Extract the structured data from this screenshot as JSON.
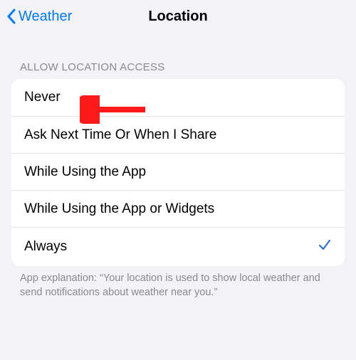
{
  "nav": {
    "back_label": "Weather",
    "title": "Location"
  },
  "section_header": "ALLOW LOCATION ACCESS",
  "options": [
    {
      "label": "Never",
      "selected": false
    },
    {
      "label": "Ask Next Time Or When I Share",
      "selected": false
    },
    {
      "label": "While Using the App",
      "selected": false
    },
    {
      "label": "While Using the App or Widgets",
      "selected": false
    },
    {
      "label": "Always",
      "selected": true
    }
  ],
  "footer": "App explanation: “Your location is used to show local weather and send notifications about weather near you.”",
  "annotation": {
    "type": "arrow",
    "color": "#ff1a1a",
    "target_option_index": 0
  },
  "colors": {
    "accent": "#007aff",
    "arrow": "#ff1a1a"
  }
}
